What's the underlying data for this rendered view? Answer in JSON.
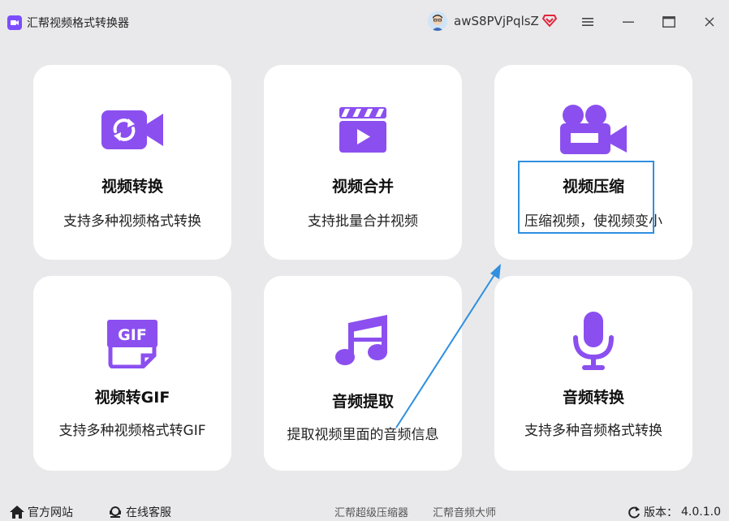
{
  "app": {
    "title": "汇帮视频格式转换器"
  },
  "user": {
    "name": "awS8PVjPqlsZ"
  },
  "colors": {
    "accent": "#8b4ff0",
    "highlight": "#2f8fe0",
    "background": "#e9e9eb"
  },
  "cards": [
    {
      "title": "视频转换",
      "desc": "支持多种视频格式转换",
      "icon": "video-convert-icon"
    },
    {
      "title": "视频合并",
      "desc": "支持批量合并视频",
      "icon": "video-merge-icon"
    },
    {
      "title": "视频压缩",
      "desc": "压缩视频，使视频变小",
      "icon": "video-compress-icon"
    },
    {
      "title": "视频转GIF",
      "desc": "支持多种视频格式转GIF",
      "icon": "gif-icon"
    },
    {
      "title": "音频提取",
      "desc": "提取视频里面的音频信息",
      "icon": "music-note-icon"
    },
    {
      "title": "音频转换",
      "desc": "支持多种音频格式转换",
      "icon": "microphone-icon"
    }
  ],
  "footer": {
    "site": "官方网站",
    "service": "在线客服",
    "compressor": "汇帮超级压缩器",
    "audio_master": "汇帮音频大师",
    "version_label": "版本：",
    "version": "4.0.1.0"
  }
}
